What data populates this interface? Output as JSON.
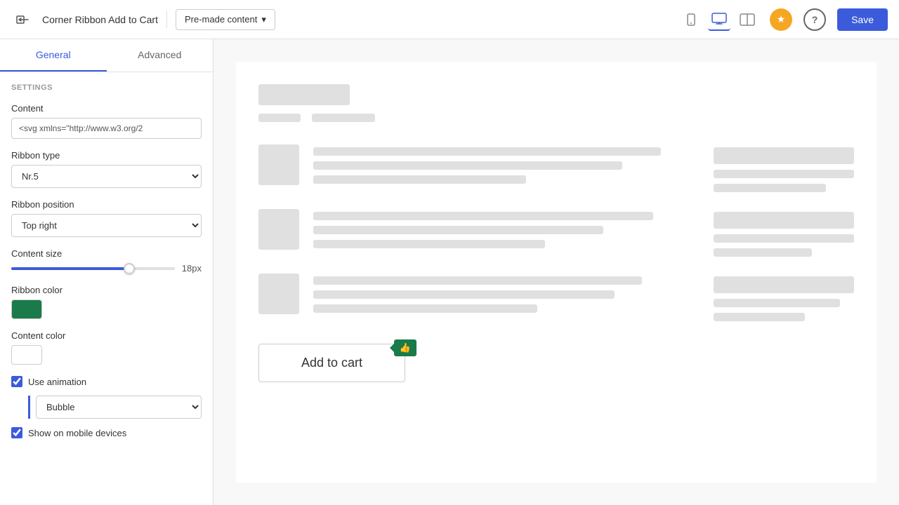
{
  "topbar": {
    "title": "Corner Ribbon Add to Cart",
    "premade_label": "Pre-made content",
    "save_label": "Save"
  },
  "tabs": {
    "general": "General",
    "advanced": "Advanced"
  },
  "sidebar": {
    "settings_label": "SETTINGS",
    "content_label": "Content",
    "content_value": "<svg xmlns=\"http://www.w3.org/2",
    "ribbon_type_label": "Ribbon type",
    "ribbon_type_value": "Nr.5",
    "ribbon_position_label": "Ribbon position",
    "ribbon_position_value": "Top right",
    "content_size_label": "Content size",
    "content_size_value": "18px",
    "ribbon_color_label": "Ribbon color",
    "ribbon_color_hex": "#1a7a4a",
    "content_color_label": "Content color",
    "content_color_hex": "#ffffff",
    "use_animation_label": "Use animation",
    "animation_type_value": "Bubble",
    "show_mobile_label": "Show on mobile devices"
  },
  "main": {
    "add_to_cart_label": "Add to cart"
  },
  "icons": {
    "back": "←",
    "chevron_down": "▾",
    "mobile": "📱",
    "desktop": "🖥",
    "tablet": "⧠",
    "star": "★",
    "help": "?",
    "thumbs_up": "👍"
  }
}
